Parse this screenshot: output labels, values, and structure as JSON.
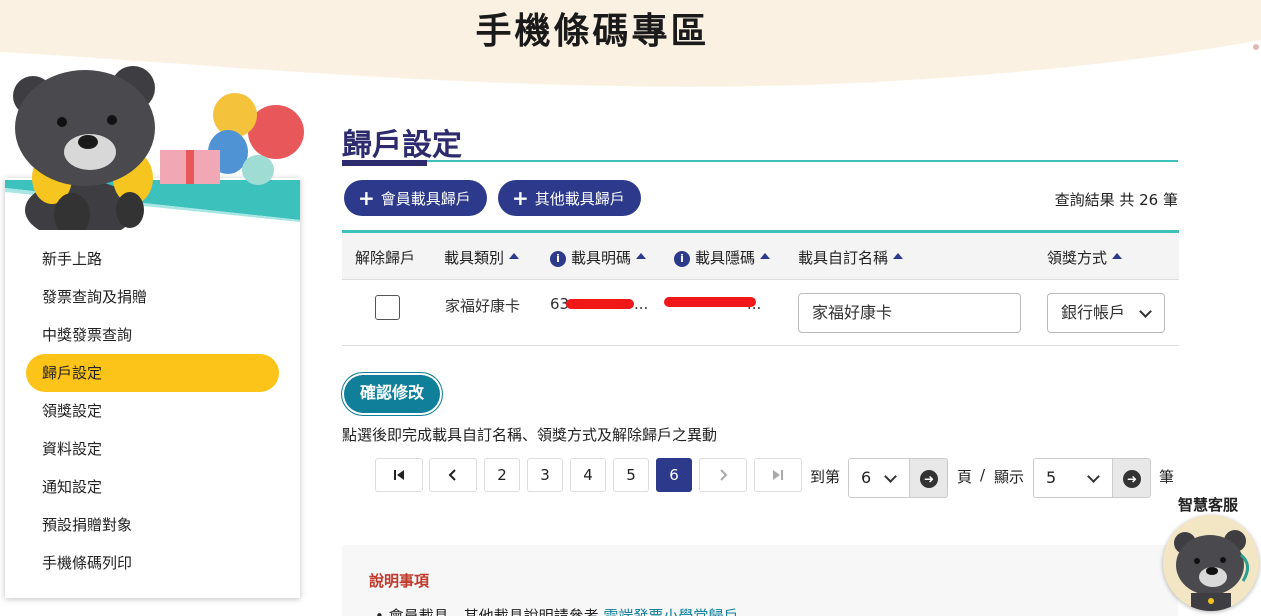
{
  "banner": {
    "title": "手機條碼專區"
  },
  "sidebar": {
    "items": [
      {
        "label": "新手上路"
      },
      {
        "label": "發票查詢及捐贈"
      },
      {
        "label": "中獎發票查詢"
      },
      {
        "label": "歸戶設定",
        "active": true
      },
      {
        "label": "領獎設定"
      },
      {
        "label": "資料設定"
      },
      {
        "label": "通知設定"
      },
      {
        "label": "預設捐贈對象"
      },
      {
        "label": "手機條碼列印"
      }
    ]
  },
  "main": {
    "title": "歸戶設定",
    "buttons": {
      "member_carrier": "會員載具歸戶",
      "other_carrier": "其他載具歸戶"
    },
    "result_count": "查詢結果 共 26 筆",
    "table": {
      "headers": [
        "解除歸戶",
        "載具類別",
        "載具明碼",
        "載具隱碼",
        "載具自訂名稱",
        "領獎方式"
      ],
      "row": {
        "type": "家福好康卡",
        "visible_code": "63",
        "hidden_code_suffix": "...",
        "custom_name": "家福好康卡",
        "prize_method": "銀行帳戶"
      }
    },
    "confirm_button": "確認修改",
    "hint": "點選後即完成載具自訂名稱、領獎方式及解除歸戶之異動"
  },
  "pagination": {
    "first_icon": "first-page-icon",
    "pages": [
      "2",
      "3",
      "4",
      "5",
      "6"
    ],
    "current_page": "6",
    "goto_label": "到第",
    "page_select": "6",
    "page_label": "頁",
    "slash": "/",
    "show_label": "顯示",
    "per_page_select": "5",
    "unit_label": "筆"
  },
  "notes": {
    "title": "說明事項",
    "item_prefix": "會員載具、其他載具說明請參考",
    "item_link": "雲端發票小學堂歸戶"
  },
  "assistant": {
    "label": "智慧客服"
  },
  "colors": {
    "navy": "#2d3a8c",
    "teal": "#3cc1bd",
    "yellow": "#fcc419",
    "confirm": "#0f7f9a"
  }
}
